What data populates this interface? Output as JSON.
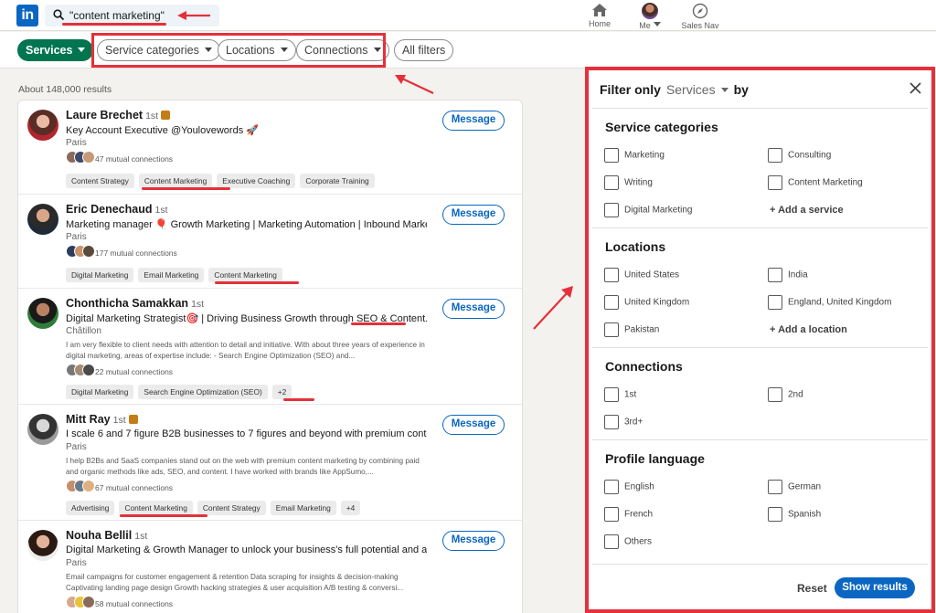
{
  "nav": {
    "search_value": "\"content marketing\"",
    "home_label": "Home",
    "me_label": "Me",
    "salesnav_label": "Sales Nav"
  },
  "filters": {
    "services": "Services",
    "service_categories": "Service categories",
    "locations": "Locations",
    "connections": "Connections",
    "all_filters": "All filters"
  },
  "results_count": "About 148,000 results",
  "results": [
    {
      "name": "Laure Brechet",
      "degree": "1st",
      "headline": "Key Account Executive @Youlovewords 🚀",
      "location": "Paris",
      "mutual": "47 mutual connections",
      "chips": [
        "Content Strategy",
        "Content Marketing",
        "Executive Coaching",
        "Corporate Training"
      ],
      "action": "Message"
    },
    {
      "name": "Eric Denechaud",
      "degree": "1st",
      "headline": "Marketing manager 🎈 Growth Marketing | Marketing Automation | Inbound Marketing |...",
      "location": "Paris",
      "mutual": "177 mutual connections",
      "chips": [
        "Digital Marketing",
        "Email Marketing",
        "Content Marketing"
      ],
      "action": "Message"
    },
    {
      "name": "Chonthicha Samakkan",
      "degree": "1st",
      "headline": "Digital Marketing Strategist🎯 | Driving Business Growth through SEO & Content...",
      "location": "Châtillon",
      "about": "I am very flexible to client needs with attention to detail and initiative. With about three years of experience in digital marketing, areas of expertise include: - Search Engine Optimization (SEO) and...",
      "mutual": "22 mutual connections",
      "chips": [
        "Digital Marketing",
        "Search Engine Optimization (SEO)",
        "+2"
      ],
      "action": "Message"
    },
    {
      "name": "Mitt Ray",
      "degree": "1st",
      "headline": "I scale 6 and 7 figure B2B businesses to 7 figures and beyond with premium content...",
      "location": "Paris",
      "about": "I help B2Bs and SaaS companies stand out on the web with premium content marketing by combining paid and organic methods like ads, SEO, and content. I have worked with brands like AppSumo,...",
      "mutual": "67 mutual connections",
      "chips": [
        "Advertising",
        "Content Marketing",
        "Content Strategy",
        "Email Marketing",
        "+4"
      ],
      "action": "Message"
    },
    {
      "name": "Nouha Bellil",
      "degree": "1st",
      "headline": "Digital Marketing & Growth Manager to unlock your business's full potential and achieve...",
      "location": "Paris",
      "about": "Email campaigns for customer engagement & retention Data scraping for insights & decision-making Captivating landing page design Growth hacking strategies & user acquisition A/B testing & conversi...",
      "mutual": "58 mutual connections",
      "chips": [],
      "action": "Message"
    }
  ],
  "panel": {
    "title_prefix": "Filter only",
    "title_select": "Services",
    "title_suffix": "by",
    "sections": {
      "service_categories": {
        "title": "Service categories",
        "options": [
          "Marketing",
          "Consulting",
          "Writing",
          "Content Marketing",
          "Digital Marketing"
        ],
        "add": "+ Add a service"
      },
      "locations": {
        "title": "Locations",
        "options": [
          "United States",
          "India",
          "United Kingdom",
          "England, United Kingdom",
          "Pakistan"
        ],
        "add": "+ Add a location"
      },
      "connections": {
        "title": "Connections",
        "options": [
          "1st",
          "2nd",
          "3rd+"
        ]
      },
      "profile_language": {
        "title": "Profile language",
        "options": [
          "English",
          "German",
          "French",
          "Spanish",
          "Others"
        ]
      }
    },
    "reset": "Reset",
    "show_results": "Show results"
  },
  "colors": {
    "linkedin_blue": "#0a66c2",
    "services_green": "#01754f",
    "annotation_red": "#e5303b",
    "premium_gold": "#c37d16"
  }
}
